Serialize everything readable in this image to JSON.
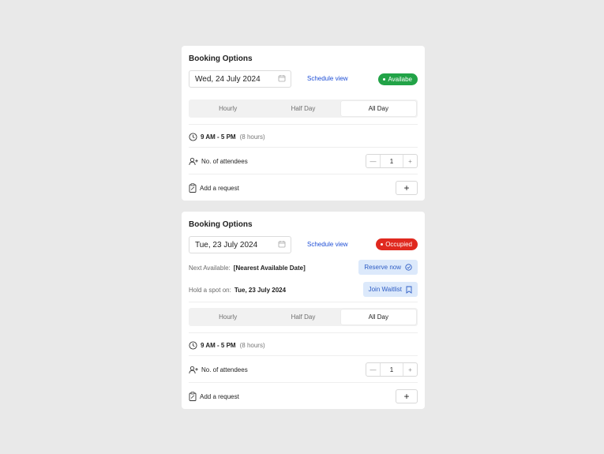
{
  "cards": [
    {
      "title": "Booking Options",
      "date": "Wed, 24 July 2024",
      "schedule_link": "Schedule view",
      "status": {
        "label": "Availabe",
        "color": "#22a347"
      },
      "segments": [
        "Hourly",
        "Half Day",
        "All Day"
      ],
      "active_segment": "All Day",
      "time_range": "9 AM - 5 PM",
      "duration": "(8 hours)",
      "attendees_label": "No. of attendees",
      "attendees_value": "1",
      "request_label": "Add a request"
    },
    {
      "title": "Booking Options",
      "date": "Tue, 23 July 2024",
      "schedule_link": "Schedule view",
      "status": {
        "label": "Occupied",
        "color": "#e0291f"
      },
      "next_available_label": "Next Available:",
      "next_available_value": "[Nearest Available Date]",
      "reserve_label": "Reserve now",
      "hold_label": "Hold a spot on:",
      "hold_value": "Tue, 23 July 2024",
      "waitlist_label": "Join Waitlist",
      "segments": [
        "Hourly",
        "Half Day",
        "All Day"
      ],
      "active_segment": "All Day",
      "time_range": "9 AM - 5 PM",
      "duration": "(8 hours)",
      "attendees_label": "No. of attendees",
      "attendees_value": "1",
      "request_label": "Add a request"
    }
  ],
  "icons": {
    "calendar": "calendar-icon",
    "clock": "clock-icon",
    "user_add": "user-add-icon",
    "clipboard": "clipboard-icon",
    "minus": "minus-icon",
    "plus": "plus-icon",
    "check_circle": "check-circle-icon",
    "bookmark": "bookmark-icon"
  }
}
